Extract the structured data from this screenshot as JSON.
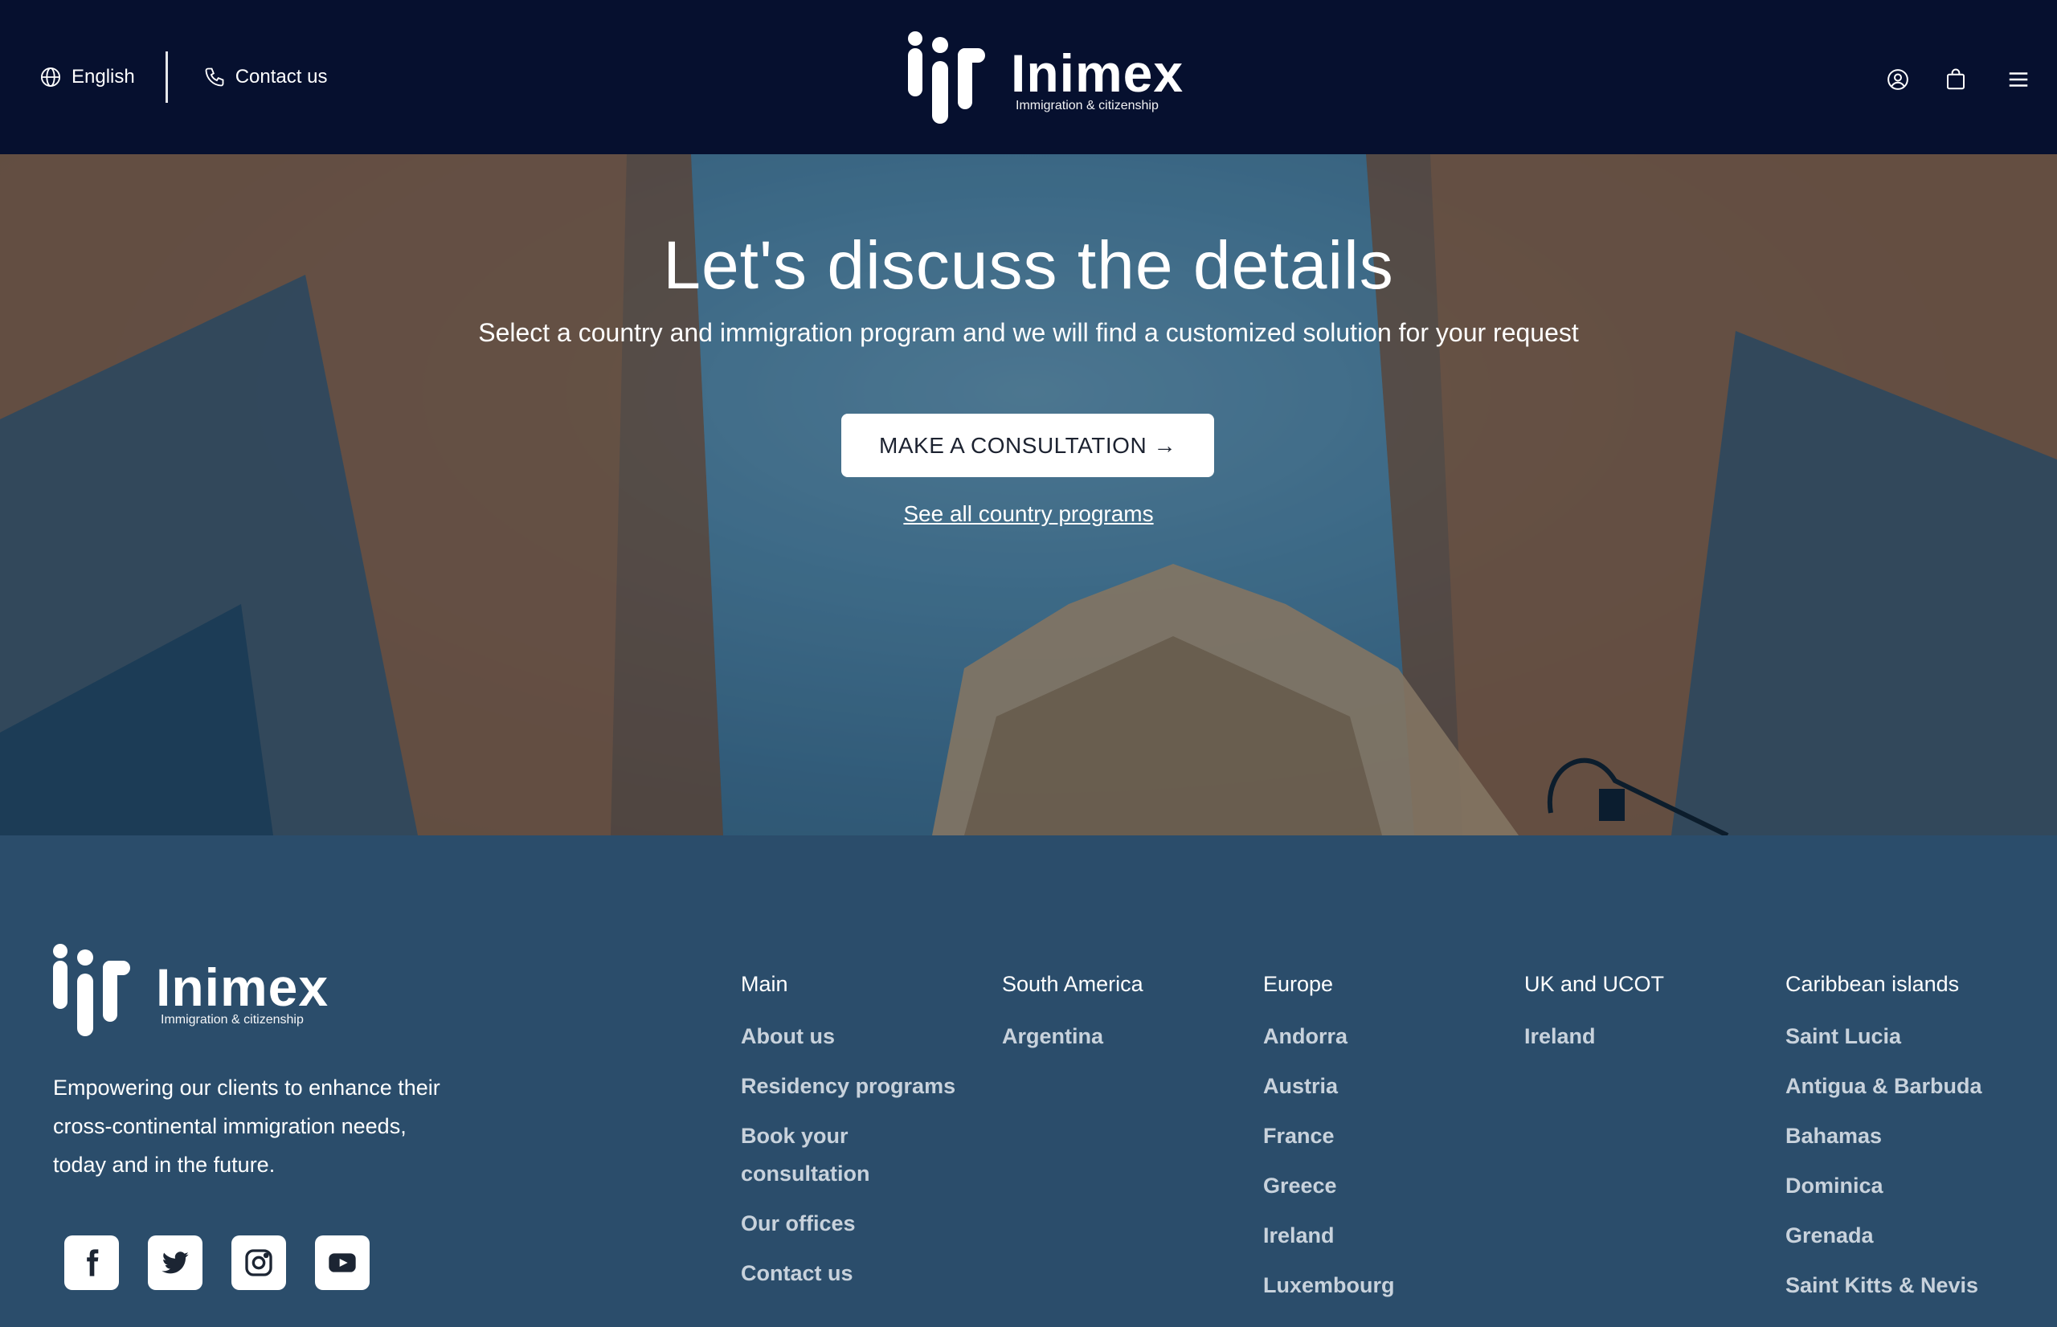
{
  "header": {
    "language_label": "English",
    "contact_label": "Contact us",
    "logo_name": "Inimex",
    "logo_tagline": "Immigration & citizenship",
    "icons": [
      "globe-icon",
      "phone-icon",
      "user-icon",
      "bag-icon",
      "menu-icon"
    ]
  },
  "hero": {
    "title": "Let's discuss the details",
    "subtitle": "Select a country and immigration program and we will find a customized solution for your request",
    "cta_label": "MAKE A CONSULTATION →",
    "see_all_label": "See all country programs"
  },
  "footer": {
    "logo_name": "Inimex",
    "logo_tagline": "Immigration & citizenship",
    "description_lines": [
      "Empowering our clients to enhance their",
      "cross-continental immigration needs,",
      "today and in the future."
    ],
    "social": [
      "facebook-icon",
      "twitter-icon",
      "instagram-icon",
      "youtube-icon"
    ],
    "columns": [
      {
        "heading": "Main",
        "links": [
          "About us",
          "Residency programs",
          "Book your consultation",
          "Our offices",
          "Contact us"
        ]
      },
      {
        "heading": "South America",
        "links": [
          "Argentina"
        ]
      },
      {
        "heading": "Europe",
        "links": [
          "Andorra",
          "Austria",
          "France",
          "Greece",
          "Ireland",
          "Luxembourg"
        ]
      },
      {
        "heading": "UK and UCOT",
        "links": [
          "Ireland"
        ]
      },
      {
        "heading": "Caribbean islands",
        "links": [
          "Saint Lucia",
          "Antigua & Barbuda",
          "Bahamas",
          "Dominica",
          "Grenada",
          "Saint Kitts & Nevis"
        ]
      }
    ]
  },
  "colors": {
    "header_bg": "#06102f",
    "footer_bg": "#2b4d6b",
    "cta_bg": "#ffffff",
    "link_muted": "#c8d2dc"
  }
}
